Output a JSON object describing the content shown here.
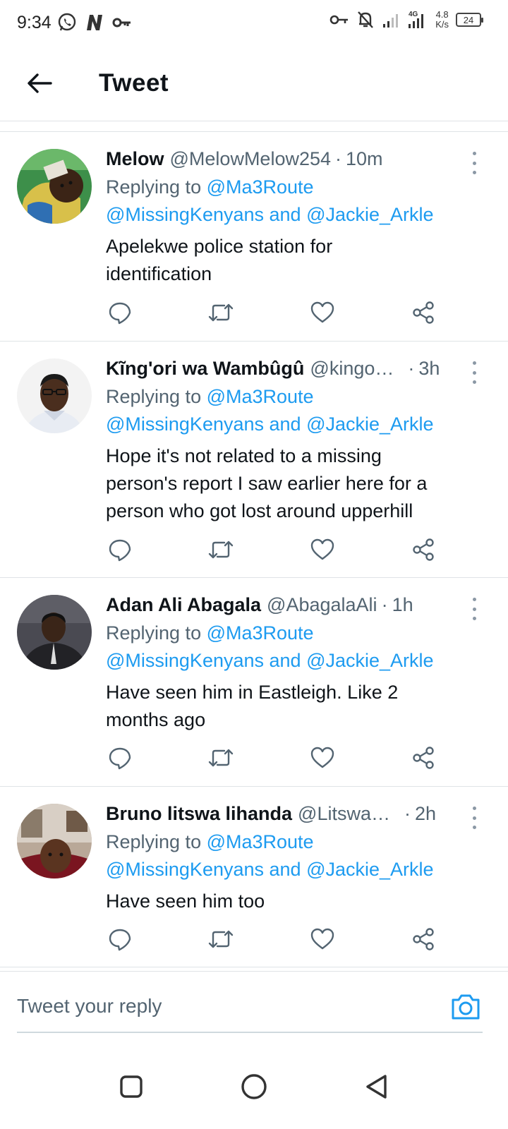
{
  "status_bar": {
    "time": "9:34",
    "net_speed_value": "4.8",
    "net_speed_unit": "K/s",
    "network_type": "4G",
    "battery": "24"
  },
  "header": {
    "title": "Tweet"
  },
  "colors": {
    "accent": "#1d9bf0",
    "secondary_text": "#536471",
    "divider": "#dfe3e6"
  },
  "tweets": [
    {
      "name": "Melow",
      "handle": "@MelowMelow254",
      "time": "10m",
      "replying_prefix": "Replying to ",
      "mention1": "@Ma3Route",
      "mention2": "@MissingKenyans",
      "and": " and ",
      "mention3": "@Jackie_Arkle",
      "text_lines": [
        "Apelekwe police station for",
        "identification"
      ]
    },
    {
      "name": "Kĩng'ori wa Wambûgû",
      "handle": "@kingo…",
      "time": "3h",
      "replying_prefix": "Replying to ",
      "mention1": "@Ma3Route",
      "mention2": "@MissingKenyans",
      "and": " and ",
      "mention3": "@Jackie_Arkle",
      "text_lines": [
        "Hope it's not related to a missing",
        "person's report I saw earlier here for a",
        "person who got lost around upperhill"
      ]
    },
    {
      "name": "Adan Ali Abagala",
      "handle": "@AbagalaAli",
      "time": "1h",
      "replying_prefix": "Replying to ",
      "mention1": "@Ma3Route",
      "mention2": "@MissingKenyans",
      "and": " and ",
      "mention3": "@Jackie_Arkle",
      "text_lines": [
        "Have seen him in Eastleigh. Like 2",
        "months ago"
      ]
    },
    {
      "name": "Bruno litswa lihanda",
      "handle": "@Litswa…",
      "time": "2h",
      "replying_prefix": "Replying to ",
      "mention1": "@Ma3Route",
      "mention2": "@MissingKenyans",
      "and": " and ",
      "mention3": "@Jackie_Arkle",
      "text_lines": [
        "Have seen him too"
      ]
    }
  ],
  "action_icons": [
    "reply-icon",
    "retweet-icon",
    "like-icon",
    "share-icon"
  ],
  "reply_bar": {
    "placeholder": "Tweet your reply"
  },
  "nav_bar": {
    "buttons": [
      "recents-button",
      "home-button",
      "back-button"
    ]
  }
}
